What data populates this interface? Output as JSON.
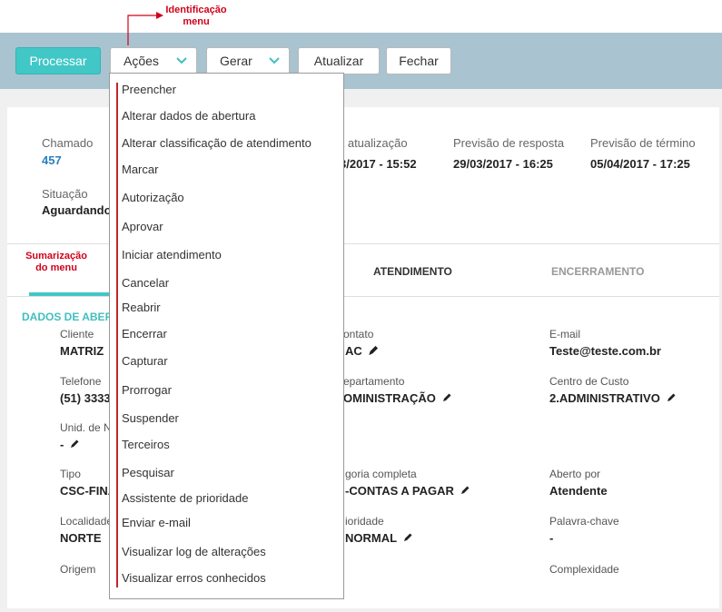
{
  "annotations": {
    "top_line1": "Identificação",
    "top_line2": "menu",
    "side_line1": "Sumarização",
    "side_line2": "do menu"
  },
  "toolbar": {
    "processar": "Processar",
    "acoes": "Ações",
    "gerar": "Gerar",
    "atualizar": "Atualizar",
    "fechar": "Fechar"
  },
  "header": {
    "chamado_label": "Chamado",
    "chamado_value": "457",
    "ultima_label": "a atualização",
    "ultima_value": "3/2017 - 15:52",
    "resposta_label": "Previsão de resposta",
    "resposta_value": "29/03/2017 - 16:25",
    "termino_label": "Previsão de término",
    "termino_value": "05/04/2017 - 17:25",
    "situacao_label": "Situação",
    "situacao_value": "Aguardando"
  },
  "tabs": {
    "atendimento": "ATENDIMENTO",
    "encerramento": "ENCERRAMENTO"
  },
  "section": {
    "title": "DADOS DE ABER"
  },
  "fields": {
    "cliente_label": "Cliente",
    "cliente_value": "MATRIZ",
    "contato_label": "ontato",
    "contato_value": "AC",
    "email_label": "E-mail",
    "email_value": "Teste@teste.com.br",
    "telefone_label": "Telefone",
    "telefone_value": "(51) 3333",
    "departamento_label": "epartamento",
    "departamento_value": "OMINISTRAÇÃO",
    "centro_label": "Centro de Custo",
    "centro_value": "2.ADMINISTRATIVO",
    "unid_label": "Unid. de Ne",
    "unid_value": "-",
    "tipo_label": "Tipo",
    "tipo_value": "CSC-FINA",
    "categoria_label": "goria completa",
    "categoria_value": "-CONTAS A PAGAR",
    "aberto_label": "Aberto por",
    "aberto_value": "Atendente",
    "localidade_label": "Localidade",
    "localidade_value": "NORTE",
    "prioridade_label": "ioridade",
    "prioridade_value": "NORMAL",
    "palavra_label": "Palavra-chave",
    "palavra_value": "-",
    "origem_label": "Origem",
    "complexidade_label": "Complexidade"
  },
  "menu": {
    "items": [
      "Preencher",
      "Alterar dados de abertura",
      "Alterar classificação de atendimento",
      "Marcar",
      "Autorização",
      "Aprovar",
      "Iniciar atendimento",
      "Cancelar",
      "Reabrir",
      "Encerrar",
      "Capturar",
      "Prorrogar",
      "Suspender",
      "Terceiros",
      "Pesquisar",
      "Assistente de prioridade",
      "Enviar e-mail",
      "Visualizar log de alterações",
      "Visualizar erros conhecidos"
    ]
  },
  "colors": {
    "accent": "#42c7c7",
    "annotation": "#d0021b",
    "toolbar_bg": "#a9c3d0",
    "link": "#2a7fbf"
  }
}
